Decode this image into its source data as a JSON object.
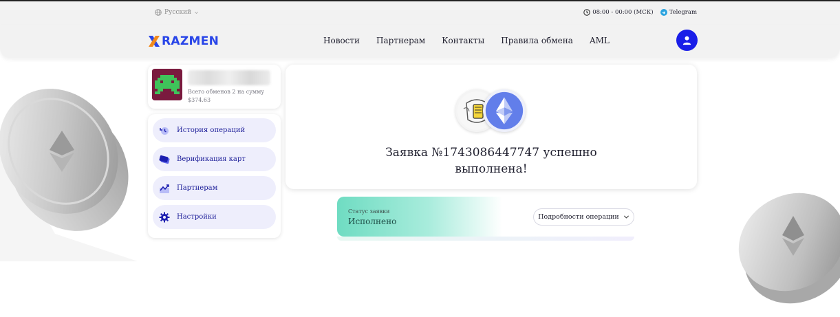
{
  "topbar": {
    "language": "Русский",
    "hours": "08:00 - 00:00 (МСК)",
    "telegram": "Telegram"
  },
  "header": {
    "logo_text": "RAZMEN",
    "nav": [
      "Новости",
      "Партнерам",
      "Контакты",
      "Правила обмена",
      "AML"
    ]
  },
  "profile": {
    "summary": "Всего обменов 2 на сумму $374.63"
  },
  "sidebar": {
    "items": [
      {
        "label": "История операций",
        "icon": "history-icon"
      },
      {
        "label": "Верификация карт",
        "icon": "card-icon"
      },
      {
        "label": "Партнерам",
        "icon": "partners-chart-icon"
      },
      {
        "label": "Настройки",
        "icon": "gear-icon"
      }
    ]
  },
  "order": {
    "title_line1": "Заявка №1743086447747 успешно",
    "title_line2": "выполнена!",
    "status_label": "Статус заявки",
    "status_value": "Исполнено",
    "details_label": "Подробности операции"
  },
  "colors": {
    "brand": "#2845e8",
    "avatar_button": "#1a1ee8",
    "menu_bg": "#eeeefc",
    "menu_text": "#23249c",
    "status_green": "#6fdcc2",
    "eth": "#627eea"
  }
}
